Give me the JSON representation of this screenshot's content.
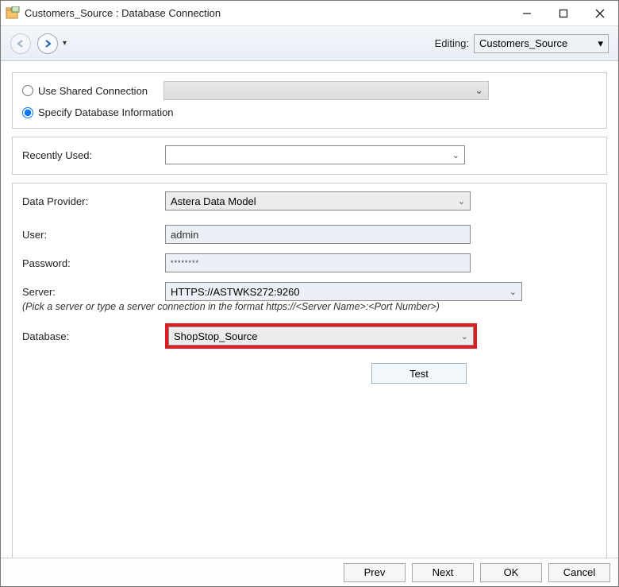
{
  "window": {
    "title": "Customers_Source : Database Connection"
  },
  "toolbar": {
    "editing_label": "Editing:",
    "editing_value": "Customers_Source"
  },
  "conn": {
    "use_shared_label": "Use Shared Connection",
    "specify_label": "Specify Database Information"
  },
  "recent": {
    "label": "Recently Used:",
    "value": ""
  },
  "fields": {
    "data_provider_label": "Data Provider:",
    "data_provider_value": "Astera Data Model",
    "user_label": "User:",
    "user_value": "admin",
    "password_label": "Password:",
    "password_value": "********",
    "server_label": "Server:",
    "server_value": "HTTPS://ASTWKS272:9260",
    "server_hint": "(Pick a server or type a server connection in the format  https://<Server Name>:<Port Number>)",
    "database_label": "Database:",
    "database_value": "ShopStop_Source",
    "test_label": "Test"
  },
  "footer": {
    "prev": "Prev",
    "next": "Next",
    "ok": "OK",
    "cancel": "Cancel"
  }
}
